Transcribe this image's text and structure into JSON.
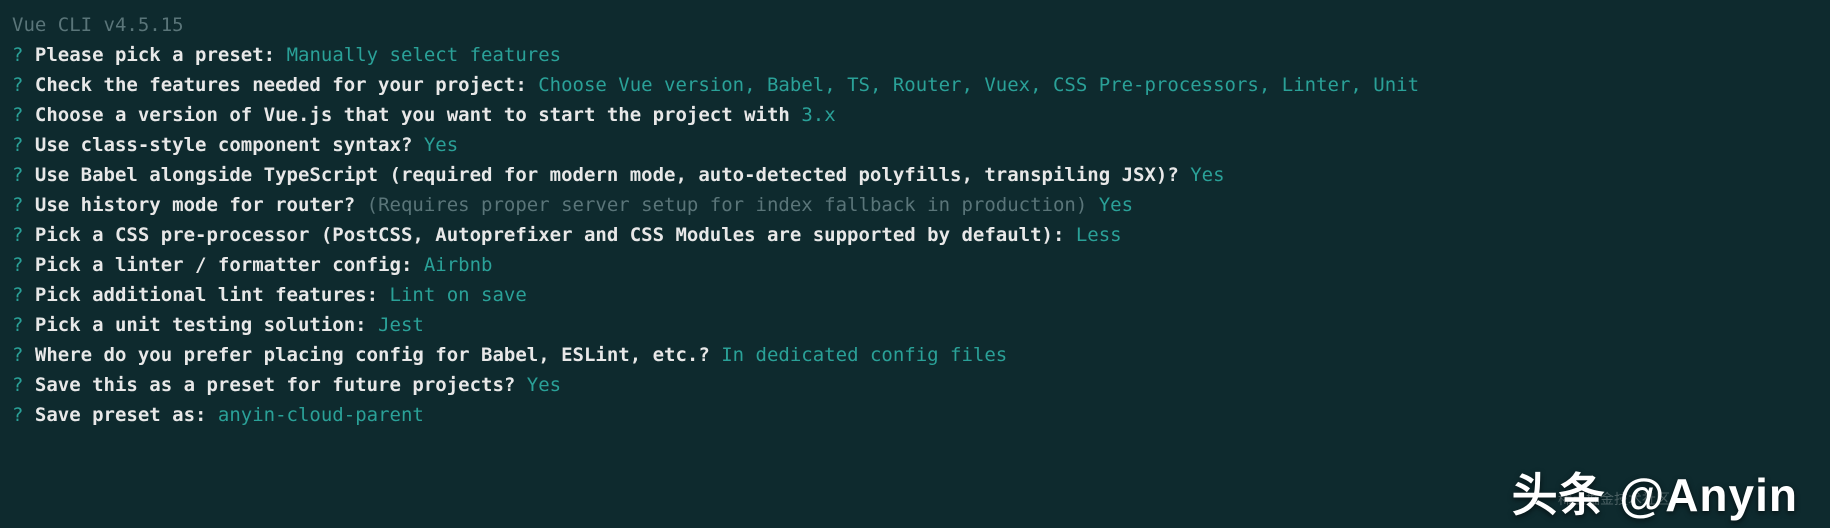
{
  "header": "Vue CLI v4.5.15",
  "lines": [
    {
      "q": "?",
      "prompt": " Please pick a preset: ",
      "answer": "Manually select features",
      "hint": ""
    },
    {
      "q": "?",
      "prompt": " Check the features needed for your project: ",
      "answer": "Choose Vue version, Babel, TS, Router, Vuex, CSS Pre-processors, Linter, Unit",
      "hint": ""
    },
    {
      "q": "?",
      "prompt": " Choose a version of Vue.js that you want to start the project with ",
      "answer": "3.x",
      "hint": ""
    },
    {
      "q": "?",
      "prompt": " Use class-style component syntax? ",
      "answer": "Yes",
      "hint": ""
    },
    {
      "q": "?",
      "prompt": " Use Babel alongside TypeScript (required for modern mode, auto-detected polyfills, transpiling JSX)? ",
      "answer": "Yes",
      "hint": ""
    },
    {
      "q": "?",
      "prompt": " Use history mode for router? ",
      "hint": "(Requires proper server setup for index fallback in production) ",
      "answer": "Yes"
    },
    {
      "q": "?",
      "prompt": " Pick a CSS pre-processor (PostCSS, Autoprefixer and CSS Modules are supported by default): ",
      "answer": "Less",
      "hint": ""
    },
    {
      "q": "?",
      "prompt": " Pick a linter / formatter config: ",
      "answer": "Airbnb",
      "hint": ""
    },
    {
      "q": "?",
      "prompt": " Pick additional lint features: ",
      "answer": "Lint on save",
      "hint": ""
    },
    {
      "q": "?",
      "prompt": " Pick a unit testing solution: ",
      "answer": "Jest",
      "hint": ""
    },
    {
      "q": "?",
      "prompt": " Where do you prefer placing config for Babel, ESLint, etc.? ",
      "answer": "In dedicated config files",
      "hint": ""
    },
    {
      "q": "?",
      "prompt": " Save this as a preset for future projects? ",
      "answer": "Yes",
      "hint": ""
    },
    {
      "q": "?",
      "prompt": " Save preset as: ",
      "answer": "anyin-cloud-parent",
      "hint": ""
    }
  ],
  "watermark": "头条 @Anyin",
  "subwatermark": "稀土掘金技术社区"
}
